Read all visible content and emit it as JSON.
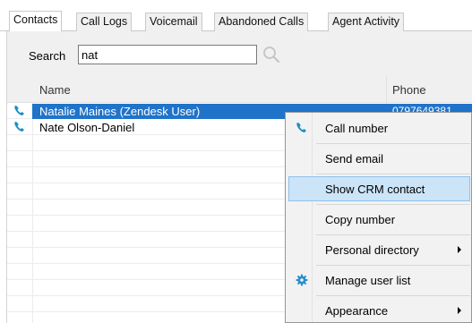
{
  "tabs": [
    {
      "label": "Contacts",
      "active": true
    },
    {
      "label": "Call Logs",
      "active": false
    },
    {
      "label": "Voicemail",
      "active": false
    },
    {
      "label": "Abandoned Calls",
      "active": false
    },
    {
      "label": "Agent Activity",
      "active": false
    }
  ],
  "search": {
    "label": "Search",
    "value": "nat",
    "button_icon": "magnifier-icon"
  },
  "columns": {
    "name": "Name",
    "phone": "Phone"
  },
  "contacts": [
    {
      "name": "Natalie Maines (Zendesk User)",
      "phone": "0797649381",
      "selected": true,
      "icon": "phone-icon"
    },
    {
      "name": "Nate Olson-Daniel",
      "phone": "",
      "selected": false,
      "icon": "phone-icon"
    }
  ],
  "context_menu": {
    "items": [
      {
        "label": "Call number",
        "icon": "phone-icon",
        "submenu": false
      },
      {
        "label": "Send email",
        "icon": "",
        "submenu": false
      },
      {
        "label": "Show CRM contact",
        "icon": "",
        "submenu": false,
        "highlighted": true
      },
      {
        "label": "Copy number",
        "icon": "",
        "submenu": false
      },
      {
        "label": "Personal directory",
        "icon": "",
        "submenu": true
      },
      {
        "label": "Manage user list",
        "icon": "gear-icon",
        "submenu": false
      },
      {
        "label": "Appearance",
        "icon": "",
        "submenu": true
      }
    ]
  },
  "colors": {
    "selection": "#1f73c9",
    "menu_highlight": "#cce4f7",
    "phone_icon": "#1a8fc7"
  }
}
